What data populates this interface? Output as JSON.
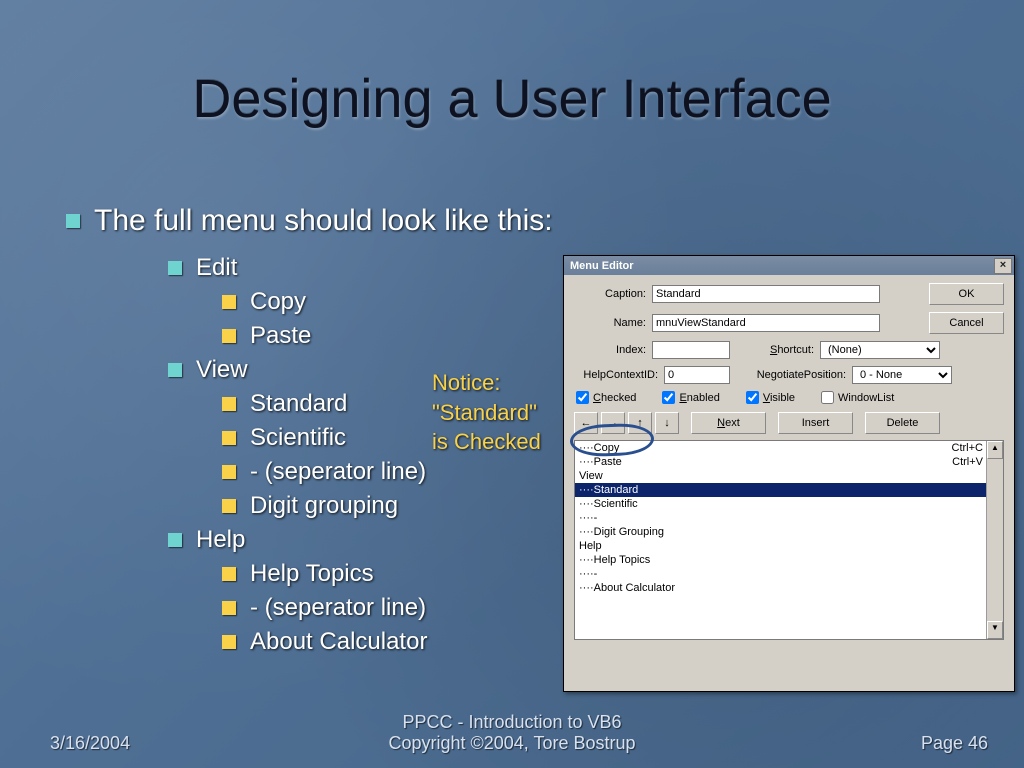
{
  "title": "Designing a User Interface",
  "bullets": {
    "intro": "The full menu should look like this:",
    "edit": "Edit",
    "copy": "Copy",
    "paste": "Paste",
    "view": "View",
    "standard": "Standard",
    "scientific": "Scientific",
    "sep1": "- (seperator line)",
    "digit": "Digit grouping",
    "help": "Help",
    "helptopics": "Help Topics",
    "sep2": "- (seperator line)",
    "about": "About Calculator"
  },
  "notice": {
    "l1": "Notice:",
    "l2": "\"Standard\"",
    "l3": "is Checked"
  },
  "footer": {
    "date": "3/16/2004",
    "center1": "PPCC - Introduction to VB6",
    "center2": "Copyright ©2004, Tore Bostrup",
    "page": "Page 46"
  },
  "menu_editor": {
    "title": "Menu Editor",
    "labels": {
      "caption": "Caption:",
      "name": "Name:",
      "index": "Index:",
      "shortcut": "Shortcut:",
      "help_ctx": "HelpContextID:",
      "neg_pos": "NegotiatePosition:"
    },
    "fields": {
      "caption": "Standard",
      "name": "mnuViewStandard",
      "index": "",
      "shortcut": "(None)",
      "help_ctx": "0",
      "neg_pos": "0 - None"
    },
    "checks": {
      "checked": {
        "label": "Checked",
        "value": true
      },
      "enabled": {
        "label": "Enabled",
        "value": true
      },
      "visible": {
        "label": "Visible",
        "value": true
      },
      "windowlist": {
        "label": "WindowList",
        "value": false
      }
    },
    "buttons": {
      "ok": "OK",
      "cancel": "Cancel",
      "next": "Next",
      "insert": "Insert",
      "delete": "Delete",
      "arrows": [
        "←",
        "→",
        "↑",
        "↓"
      ]
    },
    "list": [
      {
        "label": "····Copy",
        "short": "Ctrl+C",
        "selected": false
      },
      {
        "label": "····Paste",
        "short": "Ctrl+V",
        "selected": false
      },
      {
        "label": "View",
        "short": "",
        "selected": false
      },
      {
        "label": "····Standard",
        "short": "",
        "selected": true
      },
      {
        "label": "····Scientific",
        "short": "",
        "selected": false
      },
      {
        "label": "····-",
        "short": "",
        "selected": false
      },
      {
        "label": "····Digit Grouping",
        "short": "",
        "selected": false
      },
      {
        "label": "Help",
        "short": "",
        "selected": false
      },
      {
        "label": "····Help Topics",
        "short": "",
        "selected": false
      },
      {
        "label": "····-",
        "short": "",
        "selected": false
      },
      {
        "label": "····About Calculator",
        "short": "",
        "selected": false
      }
    ]
  }
}
